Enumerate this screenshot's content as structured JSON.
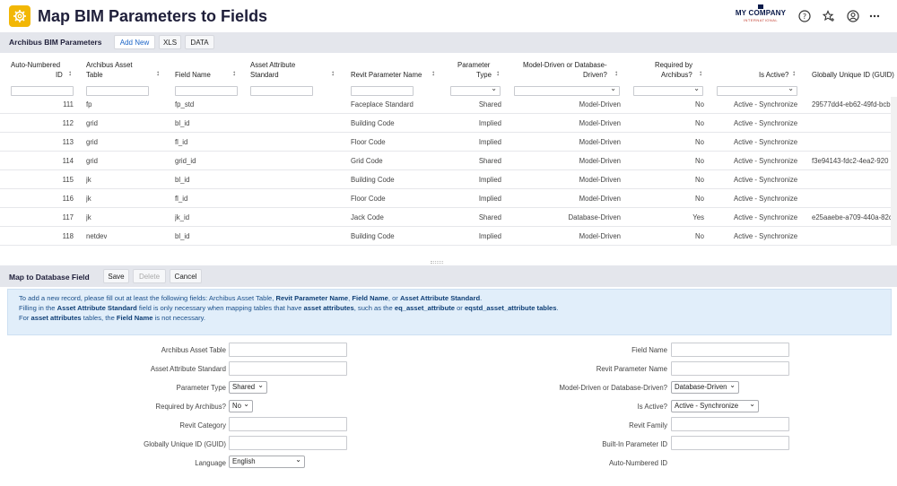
{
  "app": {
    "title": "Map BIM Parameters to Fields",
    "logo_main": "MY COMPANY",
    "logo_sub": "INTERNATIONAL",
    "icons": [
      "gear-icon",
      "help-icon",
      "favorites-icon",
      "user-icon",
      "more-icon"
    ]
  },
  "grid_panel": {
    "title": "Archibus BIM Parameters",
    "buttons": {
      "add_new": "Add New",
      "xls": "XLS",
      "data": "DATA"
    }
  },
  "columns": {
    "auto_id_l1": "Auto-Numbered",
    "auto_id_l2": "ID",
    "asset_table_l1": "Archibus Asset",
    "asset_table_l2": "Table",
    "field_name": "Field Name",
    "attr_std_l1": "Asset Attribute",
    "attr_std_l2": "Standard",
    "revit_param": "Revit Parameter Name",
    "param_type_l1": "Parameter",
    "param_type_l2": "Type",
    "driven_l1": "Model-Driven or Database-",
    "driven_l2": "Driven?",
    "required_l1": "Required by",
    "required_l2": "Archibus?",
    "active": "Is Active?",
    "guid": "Globally Unique ID (GUID)"
  },
  "rows": [
    {
      "id": "111",
      "table": "fp",
      "field": "fp_std",
      "attr": "",
      "revit": "Faceplace Standard",
      "type": "Shared",
      "driven": "Model-Driven",
      "required": "No",
      "active": "Active - Synchronize",
      "guid": "29577dd4-eb62-49fd-bcb"
    },
    {
      "id": "112",
      "table": "grid",
      "field": "bl_id",
      "attr": "",
      "revit": "Building Code",
      "type": "Implied",
      "driven": "Model-Driven",
      "required": "No",
      "active": "Active - Synchronize",
      "guid": ""
    },
    {
      "id": "113",
      "table": "grid",
      "field": "fl_id",
      "attr": "",
      "revit": "Floor Code",
      "type": "Implied",
      "driven": "Model-Driven",
      "required": "No",
      "active": "Active - Synchronize",
      "guid": ""
    },
    {
      "id": "114",
      "table": "grid",
      "field": "grid_id",
      "attr": "",
      "revit": "Grid Code",
      "type": "Shared",
      "driven": "Model-Driven",
      "required": "No",
      "active": "Active - Synchronize",
      "guid": "f3e94143-fdc2-4ea2-920"
    },
    {
      "id": "115",
      "table": "jk",
      "field": "bl_id",
      "attr": "",
      "revit": "Building Code",
      "type": "Implied",
      "driven": "Model-Driven",
      "required": "No",
      "active": "Active - Synchronize",
      "guid": ""
    },
    {
      "id": "116",
      "table": "jk",
      "field": "fl_id",
      "attr": "",
      "revit": "Floor Code",
      "type": "Implied",
      "driven": "Model-Driven",
      "required": "No",
      "active": "Active - Synchronize",
      "guid": ""
    },
    {
      "id": "117",
      "table": "jk",
      "field": "jk_id",
      "attr": "",
      "revit": "Jack Code",
      "type": "Shared",
      "driven": "Database-Driven",
      "required": "Yes",
      "active": "Active - Synchronize",
      "guid": "e25aaebe-a709-440a-82c"
    },
    {
      "id": "118",
      "table": "netdev",
      "field": "bl_id",
      "attr": "",
      "revit": "Building Code",
      "type": "Implied",
      "driven": "Model-Driven",
      "required": "No",
      "active": "Active - Synchronize",
      "guid": ""
    }
  ],
  "form_panel": {
    "title": "Map to Database Field",
    "buttons": {
      "save": "Save",
      "delete": "Delete",
      "cancel": "Cancel"
    },
    "info": {
      "l1_a": "To add a new record, please fill out at least the following fields: Archibus Asset Table, ",
      "l1_b": "Revit Parameter Name",
      "l1_c": ", ",
      "l1_d": "Field Name",
      "l1_e": ", or ",
      "l1_f": "Asset Attribute Standard",
      "l1_g": ".",
      "l2_a": "Filling in the ",
      "l2_b": "Asset Attribute Standard",
      "l2_c": " field is only necessary when mapping tables that have ",
      "l2_d": "asset attributes",
      "l2_e": ", such as the ",
      "l2_f": "eq_asset_attribute",
      "l2_g": " or ",
      "l2_h": "eqstd_asset_attribute tables",
      "l2_i": ".",
      "l3_a": "For ",
      "l3_b": "asset attributes",
      "l3_c": " tables, the ",
      "l3_d": "Field Name",
      "l3_e": " is not necessary."
    },
    "labels": {
      "asset_table": "Archibus Asset Table",
      "attr_std": "Asset Attribute Standard",
      "param_type": "Parameter Type",
      "required": "Required by Archibus?",
      "revit_category": "Revit Category",
      "guid": "Globally Unique ID (GUID)",
      "language": "Language",
      "field_name": "Field Name",
      "revit_param": "Revit Parameter Name",
      "driven": "Model-Driven or Database-Driven?",
      "active": "Is Active?",
      "revit_family": "Revit Family",
      "builtin": "Built-In Parameter ID",
      "auto_id": "Auto-Numbered ID"
    },
    "values": {
      "param_type": "Shared",
      "required": "No",
      "language": "English",
      "driven": "Database-Driven",
      "active": "Active - Synchronize"
    }
  },
  "colors": {
    "accent": "#1a63c6",
    "app_icon": "#f2b705",
    "panel_bar": "#e4e6ec",
    "info_bg": "#e1eefa"
  }
}
